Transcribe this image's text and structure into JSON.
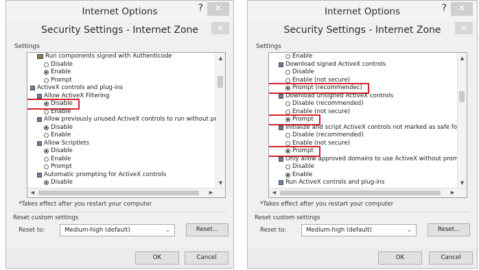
{
  "left": {
    "window_title": "Internet Options",
    "help_glyph": "?",
    "close_glyph": "✕",
    "dialog_title": "Security Settings - Internet Zone",
    "settings_label": "Settings",
    "rows": [
      {
        "icon": "pkg",
        "indent": 14,
        "text": "Run components signed with Authenticode"
      },
      {
        "icon": "radio-off",
        "indent": 24,
        "text": "Disable"
      },
      {
        "icon": "radio-on",
        "indent": 24,
        "text": "Enable"
      },
      {
        "icon": "radio-off",
        "indent": 24,
        "text": "Prompt"
      },
      {
        "icon": "cat",
        "indent": 4,
        "text": "ActiveX controls and plug-ins"
      },
      {
        "icon": "cat",
        "indent": 14,
        "text": "Allow ActiveX Filtering"
      },
      {
        "icon": "radio-on",
        "indent": 24,
        "text": "Disable",
        "highlight": true
      },
      {
        "icon": "radio-off",
        "indent": 24,
        "text": "Enable"
      },
      {
        "icon": "cat",
        "indent": 14,
        "text": "Allow previously unused ActiveX controls to run without prompt"
      },
      {
        "icon": "radio-on",
        "indent": 24,
        "text": "Disable"
      },
      {
        "icon": "radio-off",
        "indent": 24,
        "text": "Enable"
      },
      {
        "icon": "cat",
        "indent": 14,
        "text": "Allow Scriptlets"
      },
      {
        "icon": "radio-on",
        "indent": 24,
        "text": "Disable"
      },
      {
        "icon": "radio-off",
        "indent": 24,
        "text": "Enable"
      },
      {
        "icon": "radio-off",
        "indent": 24,
        "text": "Prompt"
      },
      {
        "icon": "cat",
        "indent": 14,
        "text": "Automatic prompting for ActiveX controls"
      },
      {
        "icon": "radio-on",
        "indent": 24,
        "text": "Disable"
      }
    ],
    "note": "*Takes effect after you restart your computer",
    "reset_group_label": "Reset custom settings",
    "reset_to_label": "Reset to:",
    "reset_level": "Medium-high (default)",
    "reset_button": "Reset...",
    "ok_button": "OK",
    "cancel_button": "Cancel"
  },
  "right": {
    "window_title": "Internet Options",
    "help_glyph": "?",
    "close_glyph": "✕",
    "dialog_title": "Security Settings - Internet Zone",
    "settings_label": "Settings",
    "rows": [
      {
        "icon": "radio-off",
        "indent": 24,
        "text": "Enable"
      },
      {
        "icon": "cat",
        "indent": 14,
        "text": "Download signed ActiveX controls"
      },
      {
        "icon": "radio-off",
        "indent": 24,
        "text": "Disable"
      },
      {
        "icon": "radio-off",
        "indent": 24,
        "text": "Enable (not secure)"
      },
      {
        "icon": "radio-on",
        "indent": 24,
        "text": "Prompt (recommendec)",
        "highlight": true
      },
      {
        "icon": "cat",
        "indent": 14,
        "text": "Download unsigned ActiveX controls"
      },
      {
        "icon": "radio-off",
        "indent": 24,
        "text": "Disable (recommended)"
      },
      {
        "icon": "radio-off",
        "indent": 24,
        "text": "Enable (not secure)"
      },
      {
        "icon": "radio-on",
        "indent": 24,
        "text": "Prompt",
        "highlight": true
      },
      {
        "icon": "cat",
        "indent": 14,
        "text": "Initialize and script ActiveX controls not marked as safe for script"
      },
      {
        "icon": "radio-off",
        "indent": 24,
        "text": "Disable (recommended)"
      },
      {
        "icon": "radio-off",
        "indent": 24,
        "text": "Enable (not secure)"
      },
      {
        "icon": "radio-on",
        "indent": 24,
        "text": "Prompt",
        "highlight": true
      },
      {
        "icon": "cat",
        "indent": 14,
        "text": "Only allow approved domains to use ActiveX without prompt"
      },
      {
        "icon": "radio-off",
        "indent": 24,
        "text": "Disable"
      },
      {
        "icon": "radio-on",
        "indent": 24,
        "text": "Enable"
      },
      {
        "icon": "cat",
        "indent": 14,
        "text": "Run ActiveX controls and plug-ins"
      }
    ],
    "note": "*Takes effect after you restart your computer",
    "reset_group_label": "Reset custom settings",
    "reset_to_label": "Reset to:",
    "reset_level": "Medium-high (default)",
    "reset_button": "Reset...",
    "ok_button": "OK",
    "cancel_button": "Cancel"
  },
  "colors": {
    "highlight_box": "#d1202b",
    "dialog_bg": "#f0f0f0",
    "close_button": "#cfcfcf"
  },
  "icons": {
    "help": "question-mark-icon",
    "close": "close-icon",
    "category": "folder-settings-icon",
    "package": "package-icon",
    "radio_checked": "radio-checked-icon",
    "radio_unchecked": "radio-unchecked-icon",
    "scroll_up": "chevron-up-icon",
    "scroll_down": "chevron-down-icon",
    "scroll_left": "chevron-left-icon",
    "scroll_right": "chevron-right-icon",
    "combo_arrow": "chevron-down-icon"
  }
}
